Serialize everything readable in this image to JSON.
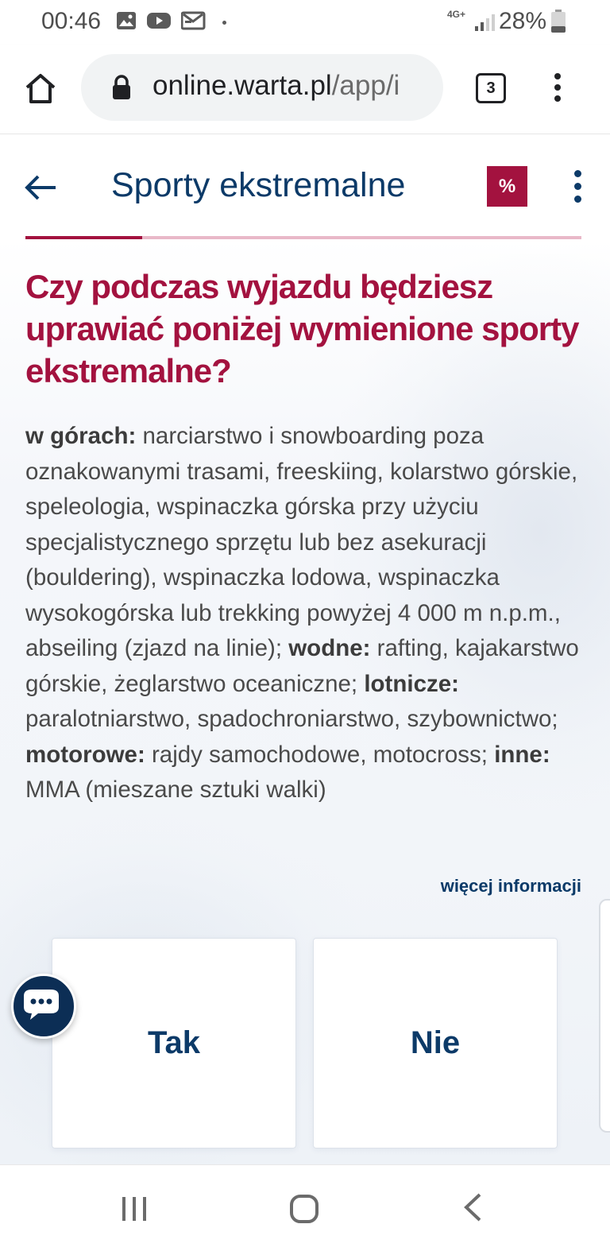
{
  "status_bar": {
    "time": "00:46",
    "network": "4G+",
    "battery": "28%",
    "icons": [
      "gallery-icon",
      "youtube-icon",
      "mail-icon",
      "dot-icon",
      "signal-icon",
      "battery-icon"
    ]
  },
  "browser": {
    "url_main": "online.warta.pl",
    "url_rest": "/app/i",
    "tab_count": "3"
  },
  "header": {
    "title": "Sporty ekstremalne",
    "promo_label": "%",
    "progress": 0.21
  },
  "question": {
    "title": "Czy podczas wyjazdu będziesz uprawiać poniżej wymienione sporty ekstremalne?"
  },
  "description": {
    "mountains_label": "w górach:",
    "mountains_text": " narciarstwo i snowboarding poza oznakowanymi trasami, freeskiing, kolarstwo górskie, speleologia, wspinaczka górska przy użyciu specjalistycznego sprzętu lub bez asekuracji (bouldering), wspinaczka lodowa, wspinaczka wysokogórska lub trekking powyżej 4 000 m n.p.m., abseiling (zjazd na linie); ",
    "water_label": "wodne:",
    "water_text": " rafting, kajakarstwo górskie, żeglarstwo oceaniczne; ",
    "air_label": "lotnicze:",
    "air_text": " paralotniarstwo, spadochroniarstwo, szybownictwo; ",
    "motor_label": "motorowe:",
    "motor_text": " rajdy samochodowe, motocross; ",
    "other_label": "inne:",
    "other_text": " MMA (mieszane sztuki walki)"
  },
  "more_info": "więcej informacji",
  "choices": {
    "yes": "Tak",
    "no": "Nie"
  },
  "colors": {
    "brand_primary": "#0c3a68",
    "brand_accent": "#a3123f"
  }
}
